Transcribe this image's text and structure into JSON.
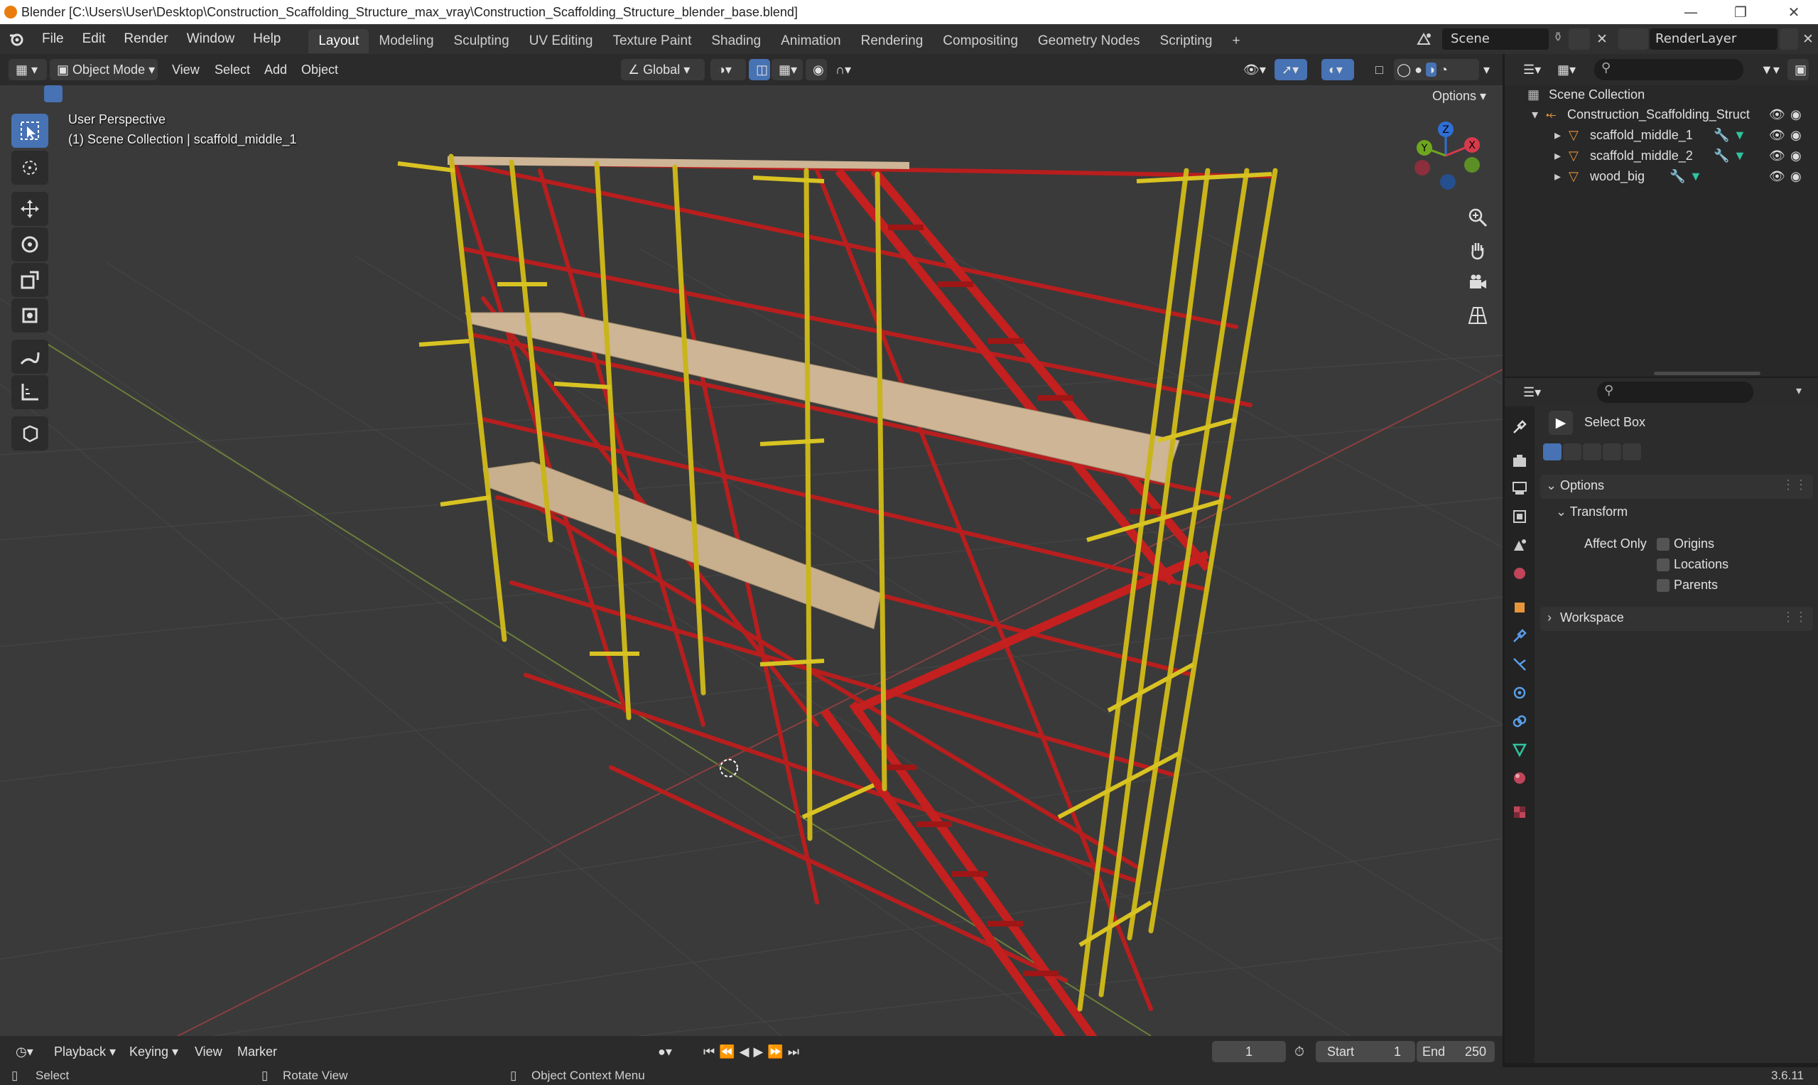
{
  "window": {
    "title": "Blender [C:\\Users\\User\\Desktop\\Construction_Scaffolding_Structure_max_vray\\Construction_Scaffolding_Structure_blender_base.blend]"
  },
  "menubar": {
    "menus": [
      "File",
      "Edit",
      "Render",
      "Window",
      "Help"
    ],
    "workspaces": [
      "Layout",
      "Modeling",
      "Sculpting",
      "UV Editing",
      "Texture Paint",
      "Shading",
      "Animation",
      "Rendering",
      "Compositing",
      "Geometry Nodes",
      "Scripting"
    ],
    "active_workspace": "Layout",
    "add_workspace": "+",
    "scene": "Scene",
    "render_layer": "RenderLayer"
  },
  "viewport_header": {
    "mode": "Object Mode",
    "menus": [
      "View",
      "Select",
      "Add",
      "Object"
    ],
    "transform_orientation": "Global",
    "options": "Options"
  },
  "viewport": {
    "perspective": "User Perspective",
    "collection_info": "(1) Scene Collection | scaffold_middle_1",
    "gizmo_axes": {
      "x": "X",
      "y": "Y",
      "z": "Z"
    }
  },
  "outliner": {
    "root": "Scene Collection",
    "collection": "Construction_Scaffolding_Struct",
    "objects": [
      "scaffold_middle_1",
      "scaffold_middle_2",
      "wood_big"
    ]
  },
  "properties": {
    "tool": "Select Box",
    "options": "Options",
    "transform": "Transform",
    "affect_only": "Affect Only",
    "origins": "Origins",
    "locations": "Locations",
    "parents": "Parents",
    "workspace": "Workspace"
  },
  "timeline": {
    "playback": "Playback",
    "keying": "Keying",
    "view": "View",
    "marker": "Marker",
    "current_frame": "1",
    "start_label": "Start",
    "start": "1",
    "end_label": "End",
    "end": "250"
  },
  "statusbar": {
    "select": "Select",
    "rotate": "Rotate View",
    "context": "Object Context Menu",
    "version": "3.6.11"
  },
  "colors": {
    "accent": "#4772b3",
    "scaffold_yellow": "#c9b51a",
    "scaffold_red": "#b81e1e",
    "wood": "#cdb596"
  }
}
